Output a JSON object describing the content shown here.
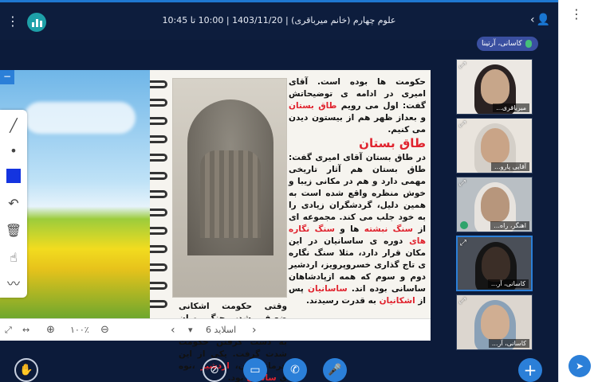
{
  "header": {
    "title": "علوم چهارم (خانم میرباقری) | 1403/11/20 | 10:00 تا 10:45",
    "menu_icon": "kebab-icon",
    "logo_icon": "audio-levels-icon",
    "user_icon": "user-icon",
    "collapse_icon": "chevron-left-icon"
  },
  "presenter_badge": {
    "label": "کاسانی، آرتینا",
    "icon": "mic-icon"
  },
  "slide": {
    "text_top": "حکومت ها بوده است. آقای امیری در ادامه ی توضیحاتش گفت: اول می رویم",
    "red_1": "طاق بستان",
    "text_top_2": "و بعداز ظهر هم از بیستون دیدن می کنیم.",
    "heading": "طاق بستان",
    "para_1": "در طاق بستان آقای امیری گفت: طاق بستان هم آثار تاریخی مهمی دارد و هم در مکانی زیبا و خوش منظره واقع شده است به همین دلیل، گردشگران زیادی را به خود جلب می کند.",
    "para_2a": "مجموعه ای از",
    "red_2": "سنگ نبشته",
    "para_2b": "ها و",
    "red_3": "سنگ نگاره های",
    "para_2c": "دوره ی ساسانیان در این مکان قرار دارد، مثلا سنگ نگاره ی تاج گذاری خسروپرویز، اردشیر دوم و سوم که همه ازپادشاهان ساسانی بوده اند.",
    "red_4": "ساسانیان",
    "para_2d": "پس از",
    "red_5": "اشکانیان",
    "para_2e": "به قدرت رسیدند.",
    "bottom_a": "وقتی حکومت اشکانی ضعیف شد، جنگ میان فرمانروایان محلی ، برای به دست گرفتن حکومت شدت گرفت. یکی از این فرمانروایان،",
    "red_6": "اردشیر",
    "bottom_b": "،نوه ی",
    "red_7": "ساسان",
    "bottom_c": "بود."
  },
  "slide_nav": {
    "slide_label": "اسلاید 6",
    "zoom": "۱۰۰٪",
    "icons": [
      "expand-icon",
      "fit-width-icon",
      "zoom-in-icon",
      "zoom-out-icon",
      "prev-icon",
      "dropdown-icon",
      "next-icon"
    ]
  },
  "tools": [
    "pen-icon",
    "dot-size-icon",
    "color-swatch",
    "undo-icon",
    "trash-icon",
    "hand-icon",
    "chart-icon"
  ],
  "tool_color": "#1434e0",
  "participants": [
    {
      "name": "میرباقری...",
      "active": false,
      "mic": false
    },
    {
      "name": "آقایی پارو...",
      "active": false,
      "mic": false
    },
    {
      "name": "اهنگر، راه...",
      "active": false,
      "mic": true
    },
    {
      "name": "کاسانی، آر...",
      "active": true,
      "mic": false
    },
    {
      "name": "کاسانی، آر...",
      "active": false,
      "mic": false
    }
  ],
  "controls": [
    "raise-hand-icon",
    "screen-share-off-icon",
    "camera-icon",
    "phone-icon",
    "microphone-icon",
    "plus-icon"
  ],
  "colors": {
    "accent": "#2b7fd8",
    "background": "#0c1b3a",
    "highlight_text": "#e0232e"
  }
}
